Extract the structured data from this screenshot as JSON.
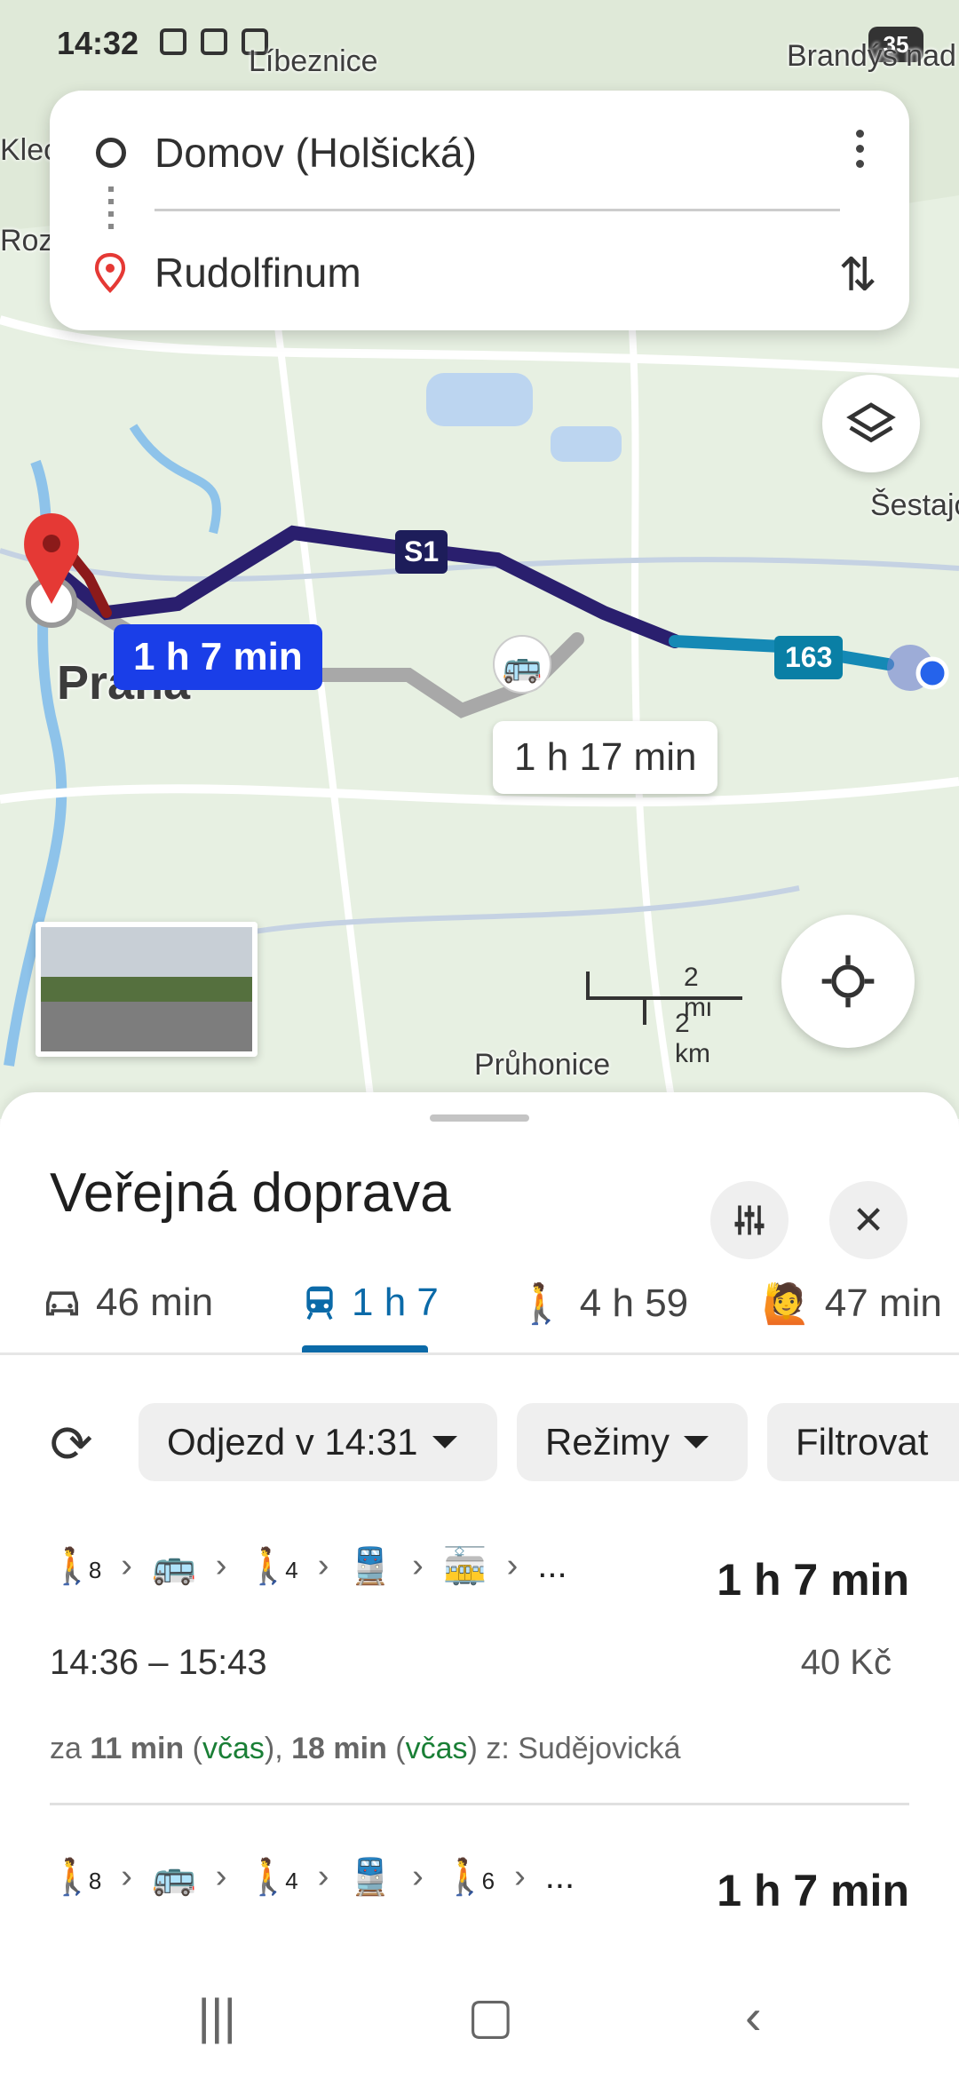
{
  "status_bar": {
    "time": "14:32",
    "battery": "35"
  },
  "map": {
    "places": [
      "Líbeznice",
      "Brandýs nad Labem-Stará Boleslav",
      "Šestajovice",
      "Praha",
      "Průhonice",
      "Klecany",
      "Roztoky"
    ],
    "route_labels": {
      "best": "1 h 7 min",
      "alternative": "1 h 17 min"
    },
    "line_badges": [
      "S1",
      "163"
    ],
    "scale": {
      "mi": "2 mi",
      "km": "2 km"
    }
  },
  "search": {
    "origin": "Domov (Holšická)",
    "destination": "Rudolfinum"
  },
  "sheet": {
    "title": "Veřejná doprava",
    "tabs": [
      {
        "icon": "car-icon",
        "label": "46 min"
      },
      {
        "icon": "train-icon",
        "label": "1 h 7"
      },
      {
        "icon": "walk-icon",
        "label": "4 h 59"
      },
      {
        "icon": "rideshare-icon",
        "label": "47 min"
      }
    ],
    "chips": {
      "depart": "Odjezd v 14:31",
      "modes": "Režimy",
      "filter": "Filtrovat"
    },
    "routes": [
      {
        "steps": [
          {
            "icon": "walk-icon",
            "sub": "8"
          },
          {
            "icon": "bus-icon",
            "sub": ""
          },
          {
            "icon": "walk-icon",
            "sub": "4"
          },
          {
            "icon": "train-icon",
            "sub": ""
          },
          {
            "icon": "tram-icon",
            "sub": ""
          }
        ],
        "ellipsis": "...",
        "duration": "1 h 7 min",
        "time_span": "14:36 – 15:43",
        "price": "40 Kč",
        "departure_a": "za ",
        "departure_a_bold": "11 min",
        "departure_a_status": "včas",
        "departure_b_bold": "18 min",
        "departure_b_status": "včas",
        "departure_from": "z: Sudějovická"
      },
      {
        "steps": [
          {
            "icon": "walk-icon",
            "sub": "8"
          },
          {
            "icon": "bus-icon",
            "sub": ""
          },
          {
            "icon": "walk-icon",
            "sub": "4"
          },
          {
            "icon": "train-icon",
            "sub": ""
          },
          {
            "icon": "walk-icon",
            "sub": "6"
          }
        ],
        "ellipsis": "...",
        "duration": "1 h 7 min"
      }
    ]
  }
}
